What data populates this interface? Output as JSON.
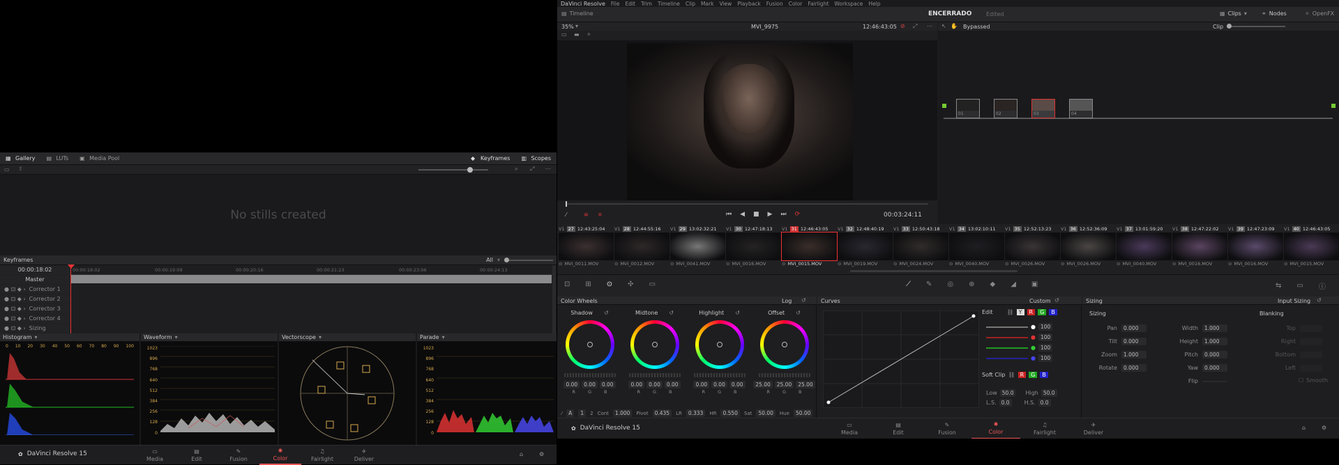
{
  "left": {
    "gallery": {
      "tabs": [
        {
          "label": "Gallery"
        },
        {
          "label": "LUTs"
        },
        {
          "label": "Media Pool"
        }
      ],
      "right_tabs": [
        {
          "label": "Keyframes"
        },
        {
          "label": "Scopes"
        }
      ],
      "empty_text": "No stills created"
    },
    "keyframes": {
      "title": "Keyframes",
      "filter": "All",
      "timecode": "00:00:18:02",
      "ruler": [
        "00:00:18:02",
        "00:00:19:09",
        "00:00:20:16",
        "00:00:21:23",
        "00:00:23:06",
        "00:00:24:13"
      ],
      "tracks": [
        "Master",
        "Corrector 1",
        "Corrector 2",
        "Corrector 3",
        "Corrector 4",
        "Sizing"
      ]
    },
    "scopes": {
      "histogram": {
        "title": "Histogram",
        "axis": [
          "0",
          "10",
          "20",
          "30",
          "40",
          "50",
          "60",
          "70",
          "80",
          "90",
          "100"
        ]
      },
      "waveform": {
        "title": "Waveform",
        "axis": [
          "1023",
          "896",
          "768",
          "640",
          "512",
          "384",
          "256",
          "128",
          "0"
        ]
      },
      "vectorscope": {
        "title": "Vectorscope"
      },
      "parade": {
        "title": "Parade",
        "axis": [
          "1023",
          "896",
          "768",
          "640",
          "512",
          "384",
          "256",
          "128",
          "0"
        ]
      }
    },
    "footer": {
      "app": "DaVinci Resolve 15",
      "nav": [
        {
          "label": "Media"
        },
        {
          "label": "Edit"
        },
        {
          "label": "Fusion"
        },
        {
          "label": "Color"
        },
        {
          "label": "Fairlight"
        },
        {
          "label": "Deliver"
        }
      ]
    }
  },
  "right": {
    "menu": [
      "DaVinci Resolve",
      "File",
      "Edit",
      "Trim",
      "Timeline",
      "Clip",
      "Mark",
      "View",
      "Playback",
      "Fusion",
      "Color",
      "Fairlight",
      "Workspace",
      "Help"
    ],
    "toolbar": {
      "timeline": "Timeline",
      "project": "ENCERRADO",
      "status": "Edited",
      "clips": "Clips",
      "nodes": "Nodes",
      "openfx": "OpenFX"
    },
    "viewer": {
      "zoom": "35%",
      "clip": "MVI_9975",
      "tc": "12:46:43:05",
      "duration": "00:03:24:11"
    },
    "nodes": {
      "bypassed": "Bypassed",
      "mode": "Clip",
      "labels": [
        "01",
        "02",
        "03",
        "04"
      ]
    },
    "clips": [
      {
        "n": "27",
        "tc": "12:43:25:04",
        "t": "V1",
        "name": "MVI_0011.MOV"
      },
      {
        "n": "28",
        "tc": "12:44:55:16",
        "t": "V1",
        "name": "MVI_0012.MOV"
      },
      {
        "n": "29",
        "tc": "13:02:32:21",
        "t": "V1",
        "name": "MVI_0041.MOV"
      },
      {
        "n": "30",
        "tc": "12:47:18:13",
        "t": "V1",
        "name": "MVI_0016.MOV"
      },
      {
        "n": "31",
        "tc": "12:46:43:05",
        "t": "V1",
        "name": "MVI_0015.MOV"
      },
      {
        "n": "32",
        "tc": "12:48:40:19",
        "t": "V1",
        "name": "MVI_0019.MOV"
      },
      {
        "n": "33",
        "tc": "12:50:43:18",
        "t": "V1",
        "name": "MVI_0024.MOV"
      },
      {
        "n": "34",
        "tc": "13:02:10:11",
        "t": "V1",
        "name": "MVI_0040.MOV"
      },
      {
        "n": "35",
        "tc": "12:52:13:23",
        "t": "V1",
        "name": "MVI_0026.MOV"
      },
      {
        "n": "36",
        "tc": "12:52:36:09",
        "t": "V1",
        "name": "MVI_0026.MOV"
      },
      {
        "n": "37",
        "tc": "13:01:59:20",
        "t": "V1",
        "name": "MVI_0040.MOV"
      },
      {
        "n": "38",
        "tc": "12:47:22:02",
        "t": "V1",
        "name": "MVI_0016.MOV"
      },
      {
        "n": "39",
        "tc": "12:47:23:09",
        "t": "V1",
        "name": "MVI_0016.MOV"
      },
      {
        "n": "40",
        "tc": "12:46:43:05",
        "t": "V1",
        "name": "MVI_0015.MOV"
      }
    ],
    "wheels": {
      "title": "Color Wheels",
      "mode": "Log",
      "items": [
        {
          "label": "Shadow",
          "r": "0.00",
          "g": "0.00",
          "b": "0.00"
        },
        {
          "label": "Midtone",
          "r": "0.00",
          "g": "0.00",
          "b": "0.00"
        },
        {
          "label": "Highlight",
          "r": "0.00",
          "g": "0.00",
          "b": "0.00"
        },
        {
          "label": "Offset",
          "r": "25.00",
          "g": "25.00",
          "b": "25.00"
        }
      ],
      "chan": [
        "R",
        "G",
        "B"
      ],
      "footer": {
        "p1": "1",
        "p2": "2",
        "cont_l": "Cont",
        "cont": "1.000",
        "pivot_l": "Pivot",
        "pivot": "0.435",
        "lr_l": "LR",
        "lr": "0.333",
        "hr_l": "HR",
        "hr": "0.550",
        "sat_l": "Sat",
        "sat": "50.00",
        "hue_l": "Hue",
        "hue": "50.00"
      }
    },
    "curves": {
      "title": "Curves",
      "mode": "Custom",
      "edit": "Edit",
      "ychan": "Y",
      "r": "R",
      "g": "G",
      "b": "B",
      "vals": [
        "100",
        "100",
        "100",
        "100"
      ],
      "softclip": "Soft Clip",
      "low_l": "Low",
      "low": "50.0",
      "high_l": "High",
      "high": "50.0",
      "ls_l": "L.S.",
      "ls": "0.0",
      "hs_l": "H.S.",
      "hs": "0.0"
    },
    "sizing": {
      "title": "Sizing",
      "mode": "Input Sizing",
      "section": "Sizing",
      "blank": "Blanking",
      "left": [
        {
          "l": "Pan",
          "v": "0.000"
        },
        {
          "l": "Tilt",
          "v": "0.000"
        },
        {
          "l": "Zoom",
          "v": "1.000"
        },
        {
          "l": "Rotate",
          "v": "0.000"
        }
      ],
      "right": [
        {
          "l": "Width",
          "v": "1.000"
        },
        {
          "l": "Height",
          "v": "1.000"
        },
        {
          "l": "Pitch",
          "v": "0.000"
        },
        {
          "l": "Yaw",
          "v": "0.000"
        },
        {
          "l": "Flip",
          "v": ""
        }
      ],
      "blanks": [
        "Top",
        "Right",
        "Bottom",
        "Left"
      ],
      "smooth": "Smooth"
    },
    "footer": {
      "app": "DaVinci Resolve 15",
      "nav": [
        {
          "label": "Media"
        },
        {
          "label": "Edit"
        },
        {
          "label": "Fusion"
        },
        {
          "label": "Color"
        },
        {
          "label": "Fairlight"
        },
        {
          "label": "Deliver"
        }
      ]
    }
  }
}
